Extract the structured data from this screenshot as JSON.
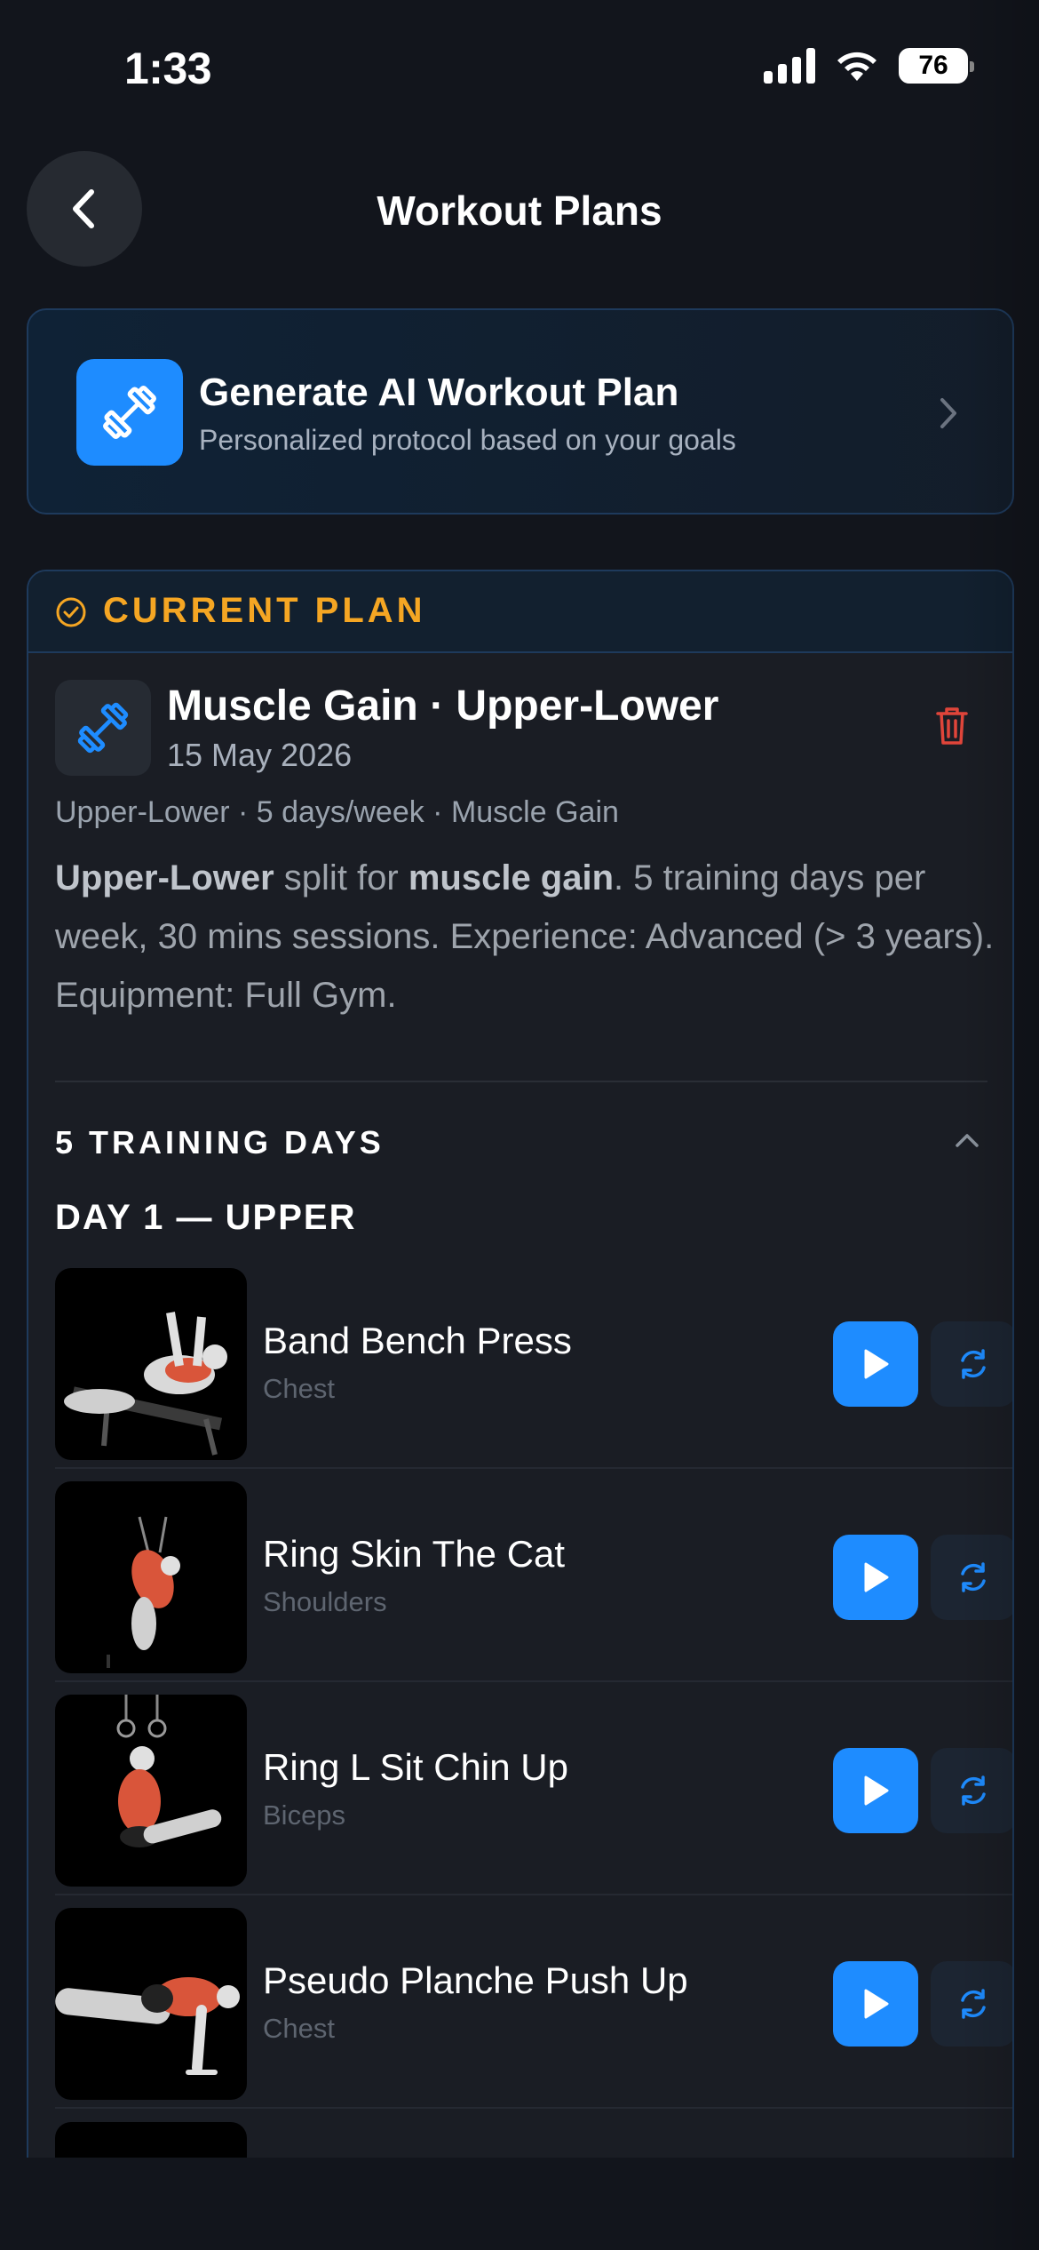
{
  "status_bar": {
    "time": "1:33",
    "battery": "76"
  },
  "header": {
    "title": "Workout Plans"
  },
  "ai_card": {
    "title": "Generate AI Workout Plan",
    "subtitle": "Personalized protocol based on your goals"
  },
  "current_plan": {
    "label": "CURRENT PLAN",
    "title": "Muscle Gain · Upper-Lower",
    "date": "15 May 2026",
    "meta": "Upper-Lower · 5 days/week · Muscle Gain",
    "description": {
      "part1": "Upper-Lower",
      "part2": " split for ",
      "part3": "muscle gain",
      "part4": ". 5 training days per week, 30 mins sessions. Experience: Advanced (> 3 years). Equipment: Full Gym."
    },
    "days_label": "5 TRAINING DAYS",
    "day_title": "DAY 1 — UPPER",
    "exercises": [
      {
        "name": "Band Bench Press",
        "muscle": "Chest"
      },
      {
        "name": "Ring Skin The Cat",
        "muscle": "Shoulders"
      },
      {
        "name": "Ring L Sit Chin Up",
        "muscle": "Biceps"
      },
      {
        "name": "Pseudo Planche Push Up",
        "muscle": "Chest"
      }
    ]
  },
  "colors": {
    "accent": "#1e8cff",
    "plan_label": "#f5a623",
    "trash": "#e0453a",
    "background": "#12151c"
  },
  "icons": [
    "back-chevron-icon",
    "dumbbell-icon",
    "chevron-right-icon",
    "check-circle-icon",
    "trash-icon",
    "chevron-up-icon",
    "play-icon",
    "swap-icon"
  ]
}
